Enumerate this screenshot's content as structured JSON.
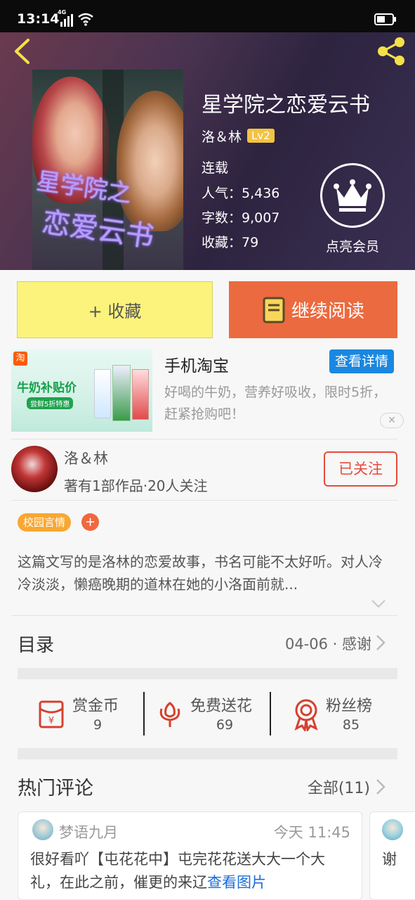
{
  "status_bar": {
    "time": "13:14",
    "network": "4G"
  },
  "book": {
    "title": "星学院之恋爱云书",
    "cover_text_line1": "星学院之",
    "cover_text_line2": "恋爱云书",
    "author": "洛＆林",
    "level": "Lv2",
    "status": "连载",
    "popularity": "人气：5,436",
    "word_count": "字数：9,007",
    "favorites": "收藏：79",
    "vip_label": "点亮会员"
  },
  "actions": {
    "favorite_label": "+ 收藏",
    "continue_label": "继续阅读"
  },
  "ad": {
    "title": "手机淘宝",
    "detail_label": "查看详情",
    "description": "好喝的牛奶，营养好吸收，限时5折，赶紧抢购吧！",
    "image_badge": "淘",
    "image_headline": "牛奶补贴价",
    "image_pill": "尝鲜5折特惠"
  },
  "author_card": {
    "name": "洛＆林",
    "meta": "著有1部作品·20人关注",
    "follow_label": "已关注"
  },
  "tags": {
    "items": [
      "校园言情"
    ],
    "add_label": "+"
  },
  "synopsis": "这篇文写的是洛林的恋爱故事，书名可能不太好听。对人冷冷淡淡，懒癌晚期的道林在她的小洛面前就...",
  "toc": {
    "title": "目录",
    "latest": "04-06 · 感谢"
  },
  "rewards": [
    {
      "label": "赏金币",
      "value": "9"
    },
    {
      "label": "免费送花",
      "value": "69"
    },
    {
      "label": "粉丝榜",
      "value": "85"
    }
  ],
  "hot_comments": {
    "title": "热门评论",
    "all_label": "全部(11)",
    "items": [
      {
        "user": "梦语九月",
        "time": "今天 11:45",
        "text": "很好看吖【屯花花中】屯完花花送大大一个大礼，在此之前，催更的来辽",
        "link": "查看图片"
      },
      {
        "text": "谢"
      }
    ]
  },
  "colors": {
    "accent_orange": "#ec6a3f",
    "favorite_yellow": "#fbf37b",
    "follow_red": "#e54b3c",
    "level_badge": "#f4c33f",
    "ad_blue": "#1a87e0",
    "tag_orange": "#f8a733"
  },
  "icons": [
    "back-icon",
    "share-icon",
    "crown-icon",
    "book-icon",
    "red-envelope-icon",
    "flower-icon",
    "medal-icon",
    "chevron-right-icon",
    "chevron-down-icon",
    "close-icon"
  ]
}
